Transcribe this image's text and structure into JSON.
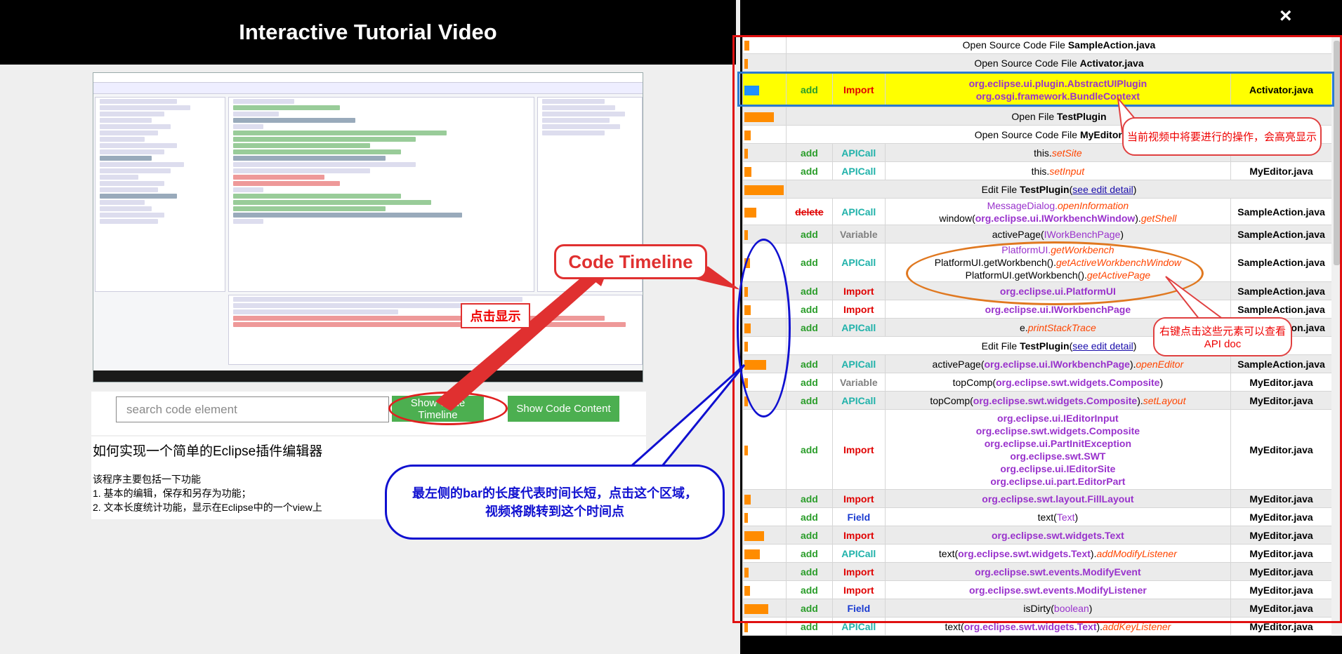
{
  "left": {
    "title": "Interactive Tutorial Video",
    "search": {
      "placeholder": "search code element"
    },
    "buttons": {
      "timeline": "Show Code Timeline",
      "content": "Show Code Content"
    },
    "description": {
      "heading": "如何实现一个简单的Eclipse插件编辑器",
      "lines": [
        "该程序主要包括一下功能",
        "1. 基本的编辑，保存和另存为功能；",
        "2. 文本长度统计功能，显示在Eclipse中的一个view上"
      ]
    }
  },
  "right": {
    "close_label": "×",
    "rows": [
      {
        "kind": "full",
        "text_prefix": "Open Source Code File ",
        "text_bold": "SampleAction.java",
        "bar": 0.12
      },
      {
        "kind": "full",
        "text_prefix": "Open Source Code File ",
        "text_bold": "Activator.java",
        "bar": 0.05
      },
      {
        "kind": "row",
        "highlight": true,
        "bar": 0.38,
        "bar_color": "blue",
        "action": "add",
        "type": "Import",
        "type_class": "t-import",
        "elements": [
          [
            {
              "t": "org.eclipse.ui.plugin.AbstractUIPlugin",
              "c": "pkg"
            }
          ],
          [
            {
              "t": "org.osgi.framework.BundleContext",
              "c": "pkg"
            }
          ]
        ],
        "file": "Activator.java"
      },
      {
        "kind": "full",
        "text_prefix": "Open File ",
        "text_bold": "TestPlugin",
        "bar": 0.75
      },
      {
        "kind": "full",
        "text_prefix": "Open Source Code File ",
        "text_bold": "MyEditor.java",
        "bar": 0.16
      },
      {
        "kind": "row",
        "bar": 0.08,
        "action": "add",
        "type": "APICall",
        "type_class": "t-apicall",
        "elements": [
          [
            {
              "t": "this.",
              "c": ""
            },
            {
              "t": "setSite",
              "c": "mth"
            }
          ]
        ],
        "file": ""
      },
      {
        "kind": "row",
        "bar": 0.18,
        "action": "add",
        "type": "APICall",
        "type_class": "t-apicall",
        "elements": [
          [
            {
              "t": "this.",
              "c": ""
            },
            {
              "t": "setInput",
              "c": "mth"
            }
          ]
        ],
        "file": "MyEditor.java"
      },
      {
        "kind": "full",
        "text_prefix": "Edit File ",
        "text_bold": "TestPlugin",
        "link": "see edit detail",
        "bar": 1.0
      },
      {
        "kind": "row",
        "bar": 0.3,
        "action": "delete",
        "type": "APICall",
        "type_class": "t-apicall",
        "elements": [
          [
            {
              "t": "MessageDialog.",
              "c": "pkg-light"
            },
            {
              "t": "openInformation",
              "c": "mth"
            }
          ],
          [
            {
              "t": "window(",
              "c": ""
            },
            {
              "t": "org.eclipse.ui.IWorkbenchWindow",
              "c": "pkg"
            },
            {
              "t": ").",
              "c": ""
            },
            {
              "t": "getShell",
              "c": "mth"
            }
          ]
        ],
        "file": "SampleAction.java"
      },
      {
        "kind": "row",
        "bar": 0.0,
        "action": "add",
        "type": "Variable",
        "type_class": "t-variable",
        "elements": [
          [
            {
              "t": "activePage(",
              "c": ""
            },
            {
              "t": "IWorkBenchPage",
              "c": "pkg-light"
            },
            {
              "t": ")",
              "c": ""
            }
          ]
        ],
        "file": "SampleAction.java"
      },
      {
        "kind": "row",
        "bar": 0.14,
        "action": "add",
        "type": "APICall",
        "type_class": "t-apicall",
        "elements": [
          [
            {
              "t": "PlatformUI.",
              "c": "pkg-light"
            },
            {
              "t": "getWorkbench",
              "c": "mth"
            }
          ],
          [
            {
              "t": "PlatformUI.getWorkbench().",
              "c": ""
            },
            {
              "t": "getActiveWorkbenchWindow",
              "c": "mth"
            }
          ],
          [
            {
              "t": "PlatformUI.getWorkbench().",
              "c": ""
            },
            {
              "t": "getActivePage",
              "c": "mth"
            }
          ]
        ],
        "file": "SampleAction.java"
      },
      {
        "kind": "row",
        "bar": 0.0,
        "action": "add",
        "type": "Import",
        "type_class": "t-import",
        "elements": [
          [
            {
              "t": "org.eclipse.ui.PlatformUI",
              "c": "pkg"
            }
          ]
        ],
        "file": "SampleAction.java"
      },
      {
        "kind": "row",
        "bar": 0.16,
        "action": "add",
        "type": "Import",
        "type_class": "t-import",
        "elements": [
          [
            {
              "t": "org.eclipse.ui.IWorkbenchPage",
              "c": "pkg"
            }
          ]
        ],
        "file": "SampleAction.java"
      },
      {
        "kind": "row",
        "bar": 0.16,
        "action": "add",
        "type": "APICall",
        "type_class": "t-apicall",
        "elements": [
          [
            {
              "t": "e.",
              "c": ""
            },
            {
              "t": "printStackTrace",
              "c": "mth"
            }
          ]
        ],
        "file": "SampleAction.java"
      },
      {
        "kind": "full",
        "text_prefix": "Edit File ",
        "text_bold": "TestPlugin",
        "link": "see edit detail",
        "bar": 0.05
      },
      {
        "kind": "row",
        "bar": 0.55,
        "action": "add",
        "type": "APICall",
        "type_class": "t-apicall",
        "elements": [
          [
            {
              "t": "activePage(",
              "c": ""
            },
            {
              "t": "org.eclipse.ui.IWorkbenchPage",
              "c": "pkg"
            },
            {
              "t": ").",
              "c": ""
            },
            {
              "t": "openEditor",
              "c": "mth"
            }
          ]
        ],
        "file": "SampleAction.java"
      },
      {
        "kind": "row",
        "bar": 0.0,
        "action": "add",
        "type": "Variable",
        "type_class": "t-variable",
        "elements": [
          [
            {
              "t": "topComp(",
              "c": ""
            },
            {
              "t": "org.eclipse.swt.widgets.Composite",
              "c": "pkg"
            },
            {
              "t": ")",
              "c": ""
            }
          ]
        ],
        "file": "MyEditor.java"
      },
      {
        "kind": "row",
        "bar": 0.0,
        "action": "add",
        "type": "APICall",
        "type_class": "t-apicall",
        "elements": [
          [
            {
              "t": "topComp(",
              "c": ""
            },
            {
              "t": "org.eclipse.swt.widgets.Composite",
              "c": "pkg"
            },
            {
              "t": ").",
              "c": ""
            },
            {
              "t": "setLayout",
              "c": "mth"
            }
          ]
        ],
        "file": "MyEditor.java"
      },
      {
        "kind": "row",
        "bar": 0.05,
        "action": "add",
        "type": "Import",
        "type_class": "t-import",
        "elements": [
          [
            {
              "t": "org.eclipse.ui.IEditorInput",
              "c": "pkg"
            }
          ],
          [
            {
              "t": "org.eclipse.swt.widgets.Composite",
              "c": "pkg"
            }
          ],
          [
            {
              "t": "org.eclipse.ui.PartInitException",
              "c": "pkg"
            }
          ],
          [
            {
              "t": "org.eclipse.swt.SWT",
              "c": "pkg"
            }
          ],
          [
            {
              "t": "org.eclipse.ui.IEditorSite",
              "c": "pkg"
            }
          ],
          [
            {
              "t": "org.eclipse.ui.part.EditorPart",
              "c": "pkg"
            }
          ]
        ],
        "file": "MyEditor.java"
      },
      {
        "kind": "row",
        "bar": 0.16,
        "action": "add",
        "type": "Import",
        "type_class": "t-import",
        "elements": [
          [
            {
              "t": "org.eclipse.swt.layout.FillLayout",
              "c": "pkg"
            }
          ]
        ],
        "file": "MyEditor.java"
      },
      {
        "kind": "row",
        "bar": 0.05,
        "action": "add",
        "type": "Field",
        "type_class": "t-field",
        "elements": [
          [
            {
              "t": "text(",
              "c": ""
            },
            {
              "t": "Text",
              "c": "pkg-light"
            },
            {
              "t": ")",
              "c": ""
            }
          ]
        ],
        "file": "MyEditor.java"
      },
      {
        "kind": "row",
        "bar": 0.5,
        "action": "add",
        "type": "Import",
        "type_class": "t-import",
        "elements": [
          [
            {
              "t": "org.eclipse.swt.widgets.Text",
              "c": "pkg"
            }
          ]
        ],
        "file": "MyEditor.java"
      },
      {
        "kind": "row",
        "bar": 0.4,
        "action": "add",
        "type": "APICall",
        "type_class": "t-apicall",
        "elements": [
          [
            {
              "t": "text(",
              "c": ""
            },
            {
              "t": "org.eclipse.swt.widgets.Text",
              "c": "pkg"
            },
            {
              "t": ").",
              "c": ""
            },
            {
              "t": "addModifyListener",
              "c": "mth"
            }
          ]
        ],
        "file": "MyEditor.java"
      },
      {
        "kind": "row",
        "bar": 0.1,
        "action": "add",
        "type": "Import",
        "type_class": "t-import",
        "elements": [
          [
            {
              "t": "org.eclipse.swt.events.ModifyEvent",
              "c": "pkg"
            }
          ]
        ],
        "file": "MyEditor.java"
      },
      {
        "kind": "row",
        "bar": 0.14,
        "action": "add",
        "type": "Import",
        "type_class": "t-import",
        "elements": [
          [
            {
              "t": "org.eclipse.swt.events.ModifyListener",
              "c": "pkg"
            }
          ]
        ],
        "file": "MyEditor.java"
      },
      {
        "kind": "row",
        "bar": 0.6,
        "action": "add",
        "type": "Field",
        "type_class": "t-field",
        "elements": [
          [
            {
              "t": "isDirty(",
              "c": ""
            },
            {
              "t": "boolean",
              "c": "pkg-light"
            },
            {
              "t": ")",
              "c": ""
            }
          ]
        ],
        "file": "MyEditor.java"
      },
      {
        "kind": "row",
        "bar": 0.0,
        "action": "add",
        "type": "APICall",
        "type_class": "t-apicall",
        "elements": [
          [
            {
              "t": "text(",
              "c": ""
            },
            {
              "t": "org.eclipse.swt.widgets.Text",
              "c": "pkg"
            },
            {
              "t": ").",
              "c": ""
            },
            {
              "t": "addKeyListener",
              "c": "mth"
            }
          ]
        ],
        "file": "MyEditor.java"
      }
    ]
  },
  "annotations": {
    "code_timeline": "Code Timeline",
    "click_show": "点击显示",
    "current_op": "当前视频中将要进行的操作，会高亮显示",
    "right_click": "右键点击这些元素可以查看API doc",
    "bar_note": "最左侧的bar的长度代表时间长短，点击这个区域，视频将跳转到这个时间点"
  },
  "colors": {
    "button_green": "#4caf50",
    "highlight": "#ffff00",
    "bar": "#ff8c00",
    "bar_current": "#1e90ff",
    "frame_red": "#e01010"
  }
}
